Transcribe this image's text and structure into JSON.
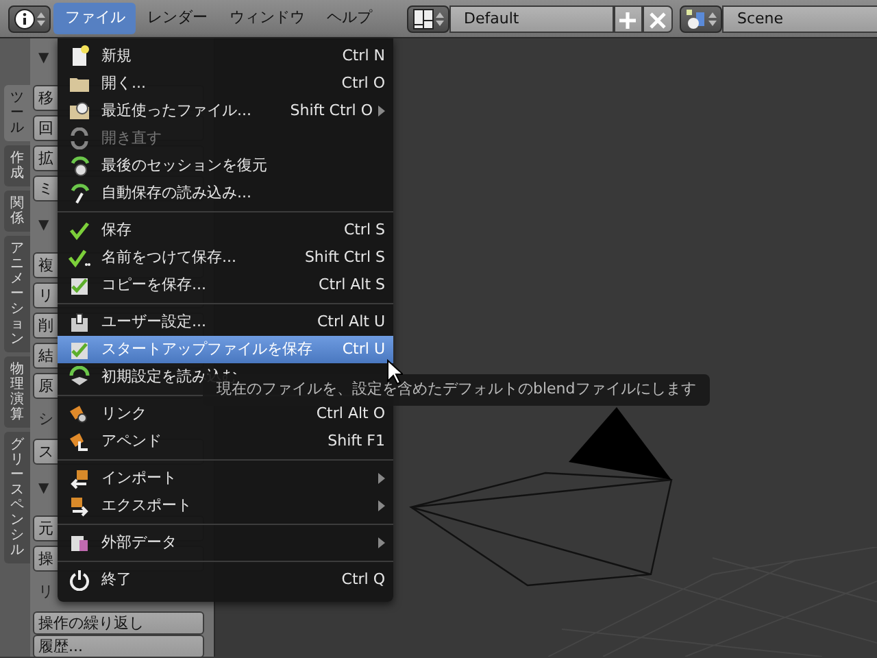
{
  "header": {
    "menus": [
      {
        "label": "ファイル",
        "selected": true
      },
      {
        "label": "レンダー",
        "selected": false
      },
      {
        "label": "ウィンドウ",
        "selected": false
      },
      {
        "label": "ヘルプ",
        "selected": false
      }
    ],
    "screen_layout": "Default",
    "scene": "Scene"
  },
  "tool_tabs": [
    {
      "label": "ツール",
      "selected": true
    },
    {
      "label": "作成",
      "selected": false
    },
    {
      "label": "関係",
      "selected": false
    },
    {
      "label": "アニメーション",
      "selected": false
    },
    {
      "label": "物理演算",
      "selected": false
    },
    {
      "label": "グリースペンシル",
      "selected": false
    }
  ],
  "tool_panel": [
    {
      "kind": "header",
      "text": "▼"
    },
    {
      "kind": "button",
      "text": "移"
    },
    {
      "kind": "button",
      "text": "回"
    },
    {
      "kind": "button",
      "text": "拡"
    },
    {
      "kind": "button",
      "text": "ミ"
    },
    {
      "kind": "header",
      "text": "▼"
    },
    {
      "kind": "button",
      "text": "複"
    },
    {
      "kind": "button",
      "text": "リ"
    },
    {
      "kind": "button",
      "text": "削"
    },
    {
      "kind": "button",
      "text": "結"
    },
    {
      "kind": "button",
      "text": "原"
    },
    {
      "kind": "label",
      "text": "シ"
    },
    {
      "kind": "button",
      "text": "ス"
    },
    {
      "kind": "header",
      "text": "▼"
    },
    {
      "kind": "button",
      "text": "元"
    },
    {
      "kind": "button",
      "text": "操"
    },
    {
      "kind": "label",
      "text": "リ"
    },
    {
      "kind": "button",
      "text": "操作の繰り返し"
    },
    {
      "kind": "button",
      "text": "履歴..."
    }
  ],
  "file_menu": [
    {
      "kind": "item",
      "label": "新規",
      "shortcut": "Ctrl N",
      "submenu": false,
      "disabled": false,
      "selected": false
    },
    {
      "kind": "item",
      "label": "開く...",
      "shortcut": "Ctrl O",
      "submenu": false,
      "disabled": false,
      "selected": false
    },
    {
      "kind": "item",
      "label": "最近使ったファイル...",
      "shortcut": "Shift Ctrl O",
      "submenu": true,
      "disabled": false,
      "selected": false
    },
    {
      "kind": "item",
      "label": "開き直す",
      "submenu": false,
      "disabled": true,
      "selected": false
    },
    {
      "kind": "item",
      "label": "最後のセッションを復元",
      "submenu": false,
      "disabled": false,
      "selected": false
    },
    {
      "kind": "item",
      "label": "自動保存の読み込み...",
      "submenu": false,
      "disabled": false,
      "selected": false
    },
    {
      "kind": "separator"
    },
    {
      "kind": "item",
      "label": "保存",
      "shortcut": "Ctrl S",
      "submenu": false,
      "disabled": false,
      "selected": false
    },
    {
      "kind": "item",
      "label": "名前をつけて保存...",
      "shortcut": "Shift Ctrl S",
      "submenu": false,
      "disabled": false,
      "selected": false
    },
    {
      "kind": "item",
      "label": "コピーを保存...",
      "shortcut": "Ctrl Alt S",
      "submenu": false,
      "disabled": false,
      "selected": false
    },
    {
      "kind": "separator"
    },
    {
      "kind": "item",
      "label": "ユーザー設定...",
      "shortcut": "Ctrl Alt U",
      "submenu": false,
      "disabled": false,
      "selected": false
    },
    {
      "kind": "item",
      "label": "スタートアップファイルを保存",
      "shortcut": "Ctrl U",
      "submenu": false,
      "disabled": false,
      "selected": true
    },
    {
      "kind": "item",
      "label": "初期設定を読み込む",
      "submenu": false,
      "disabled": false,
      "selected": false
    },
    {
      "kind": "separator"
    },
    {
      "kind": "item",
      "label": "リンク",
      "shortcut": "Ctrl Alt O",
      "submenu": false,
      "disabled": false,
      "selected": false
    },
    {
      "kind": "item",
      "label": "アペンド",
      "shortcut": "Shift F1",
      "submenu": false,
      "disabled": false,
      "selected": false
    },
    {
      "kind": "separator"
    },
    {
      "kind": "item",
      "label": "インポート",
      "submenu": true,
      "disabled": false,
      "selected": false
    },
    {
      "kind": "item",
      "label": "エクスポート",
      "submenu": true,
      "disabled": false,
      "selected": false
    },
    {
      "kind": "separator"
    },
    {
      "kind": "item",
      "label": "外部データ",
      "submenu": true,
      "disabled": false,
      "selected": false
    },
    {
      "kind": "separator"
    },
    {
      "kind": "item",
      "label": "終了",
      "shortcut": "Ctrl Q",
      "submenu": false,
      "disabled": false,
      "selected": false
    }
  ],
  "tooltip": "現在のファイルを、設定を含めたデフォルトのblendファイルにします"
}
